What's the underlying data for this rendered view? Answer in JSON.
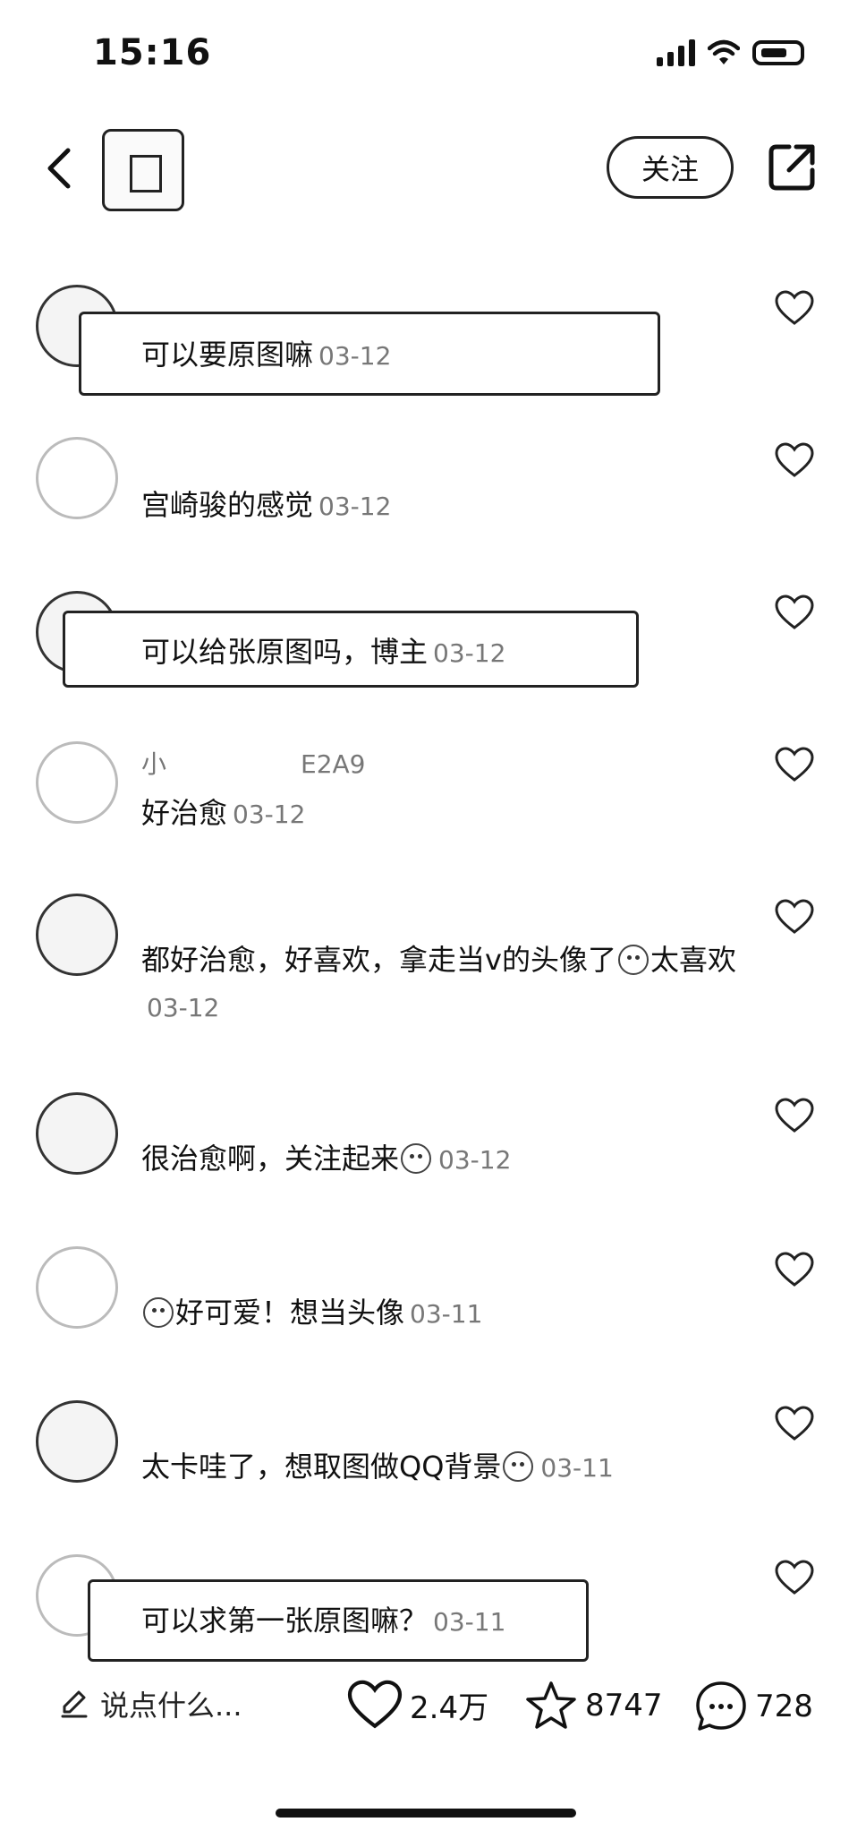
{
  "status_bar": {
    "time": "15:16",
    "icons": [
      "signal-icon",
      "wifi-icon",
      "battery-icon"
    ]
  },
  "header": {
    "follow_label": "关注"
  },
  "comments": [
    {
      "user": "",
      "text": "可以要原图嘛",
      "time": "03-12"
    },
    {
      "user": "",
      "text": "宫崎骏的感觉",
      "time": "03-12"
    },
    {
      "user": "",
      "text": "可以给张原图吗，博主",
      "time": "03-12"
    },
    {
      "user": "小",
      "user_tail": "E2A9",
      "text": "好治愈",
      "time": "03-12"
    },
    {
      "user": "",
      "text_a": "都好治愈，好喜欢，拿走当v的头像了",
      "text_b": "太喜欢",
      "time": "03-12"
    },
    {
      "user": "",
      "text": "很治愈啊，关注起来",
      "time": "03-12"
    },
    {
      "user": "",
      "text": "好可爱！想当头像",
      "time": "03-11"
    },
    {
      "user": "",
      "text": "太卡哇了，想取图做QQ背景",
      "time": "03-11"
    },
    {
      "user": "",
      "text": "可以求第一张原图嘛？",
      "time": "03-11"
    }
  ],
  "bottom_bar": {
    "input_placeholder": "说点什么...",
    "likes": "2.4万",
    "favorites": "8747",
    "comments": "728"
  }
}
